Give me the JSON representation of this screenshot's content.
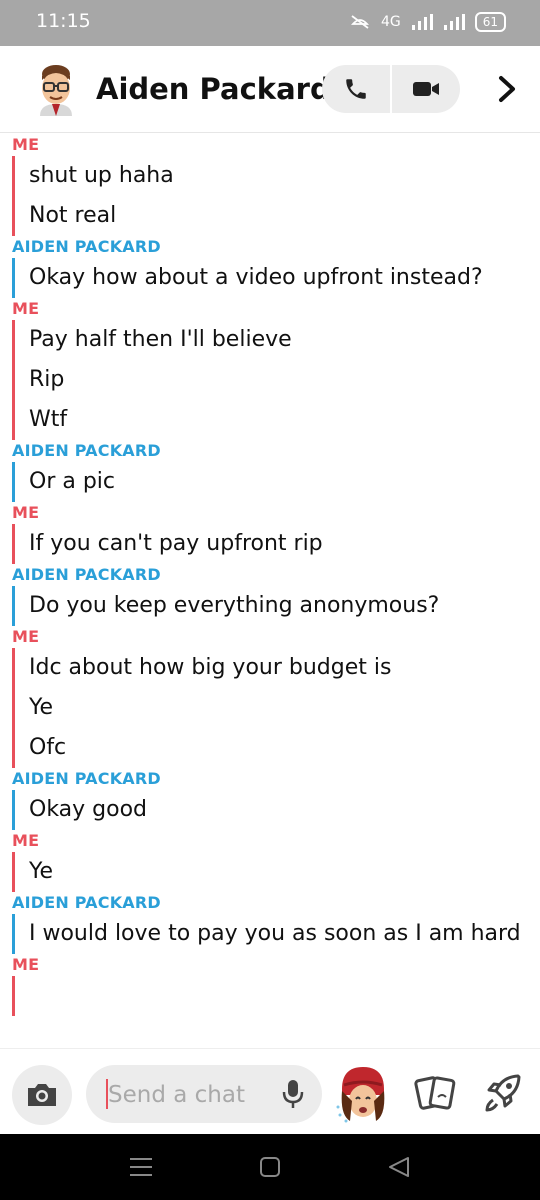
{
  "status_bar": {
    "time": "11:15",
    "network": "4G",
    "battery": "61"
  },
  "header": {
    "contact_name": "Aiden Packard"
  },
  "colors": {
    "me": "#e8505b",
    "them": "#2a9fd8"
  },
  "messages": [
    {
      "sender": "ME",
      "texts": [
        "shut up haha",
        "Not real"
      ]
    },
    {
      "sender": "AIDEN PACKARD",
      "texts": [
        "Okay how about a video upfront instead?"
      ]
    },
    {
      "sender": "ME",
      "texts": [
        "Pay half then I'll believe",
        "Rip",
        "Wtf"
      ]
    },
    {
      "sender": "AIDEN PACKARD",
      "texts": [
        "Or a pic"
      ]
    },
    {
      "sender": "ME",
      "texts": [
        "If you can't pay upfront rip"
      ]
    },
    {
      "sender": "AIDEN PACKARD",
      "texts": [
        "Do you keep everything anonymous?"
      ]
    },
    {
      "sender": "ME",
      "texts": [
        "Idc about how big your budget is",
        "Ye",
        "Ofc"
      ]
    },
    {
      "sender": "AIDEN PACKARD",
      "texts": [
        "Okay good"
      ]
    },
    {
      "sender": "ME",
      "texts": [
        "Ye"
      ]
    },
    {
      "sender": "AIDEN PACKARD",
      "texts": [
        "I would love to pay you as soon as I am hard"
      ]
    },
    {
      "sender": "ME",
      "texts": [
        ""
      ]
    }
  ],
  "composer": {
    "placeholder": "Send a chat"
  },
  "icons": {
    "phone": "phone-icon",
    "video": "video-camera-icon",
    "forward": "chevron-right-icon",
    "camera": "camera-icon",
    "mic": "microphone-icon",
    "stickers": "cards-icon",
    "games": "rocket-icon"
  }
}
